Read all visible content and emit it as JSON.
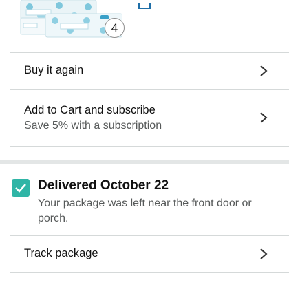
{
  "product": {
    "quantity": "4",
    "image": "tissue-pack-product-photo"
  },
  "actions": {
    "buy_again": "Buy it again",
    "subscribe_title": "Add to Cart and subscribe",
    "subscribe_sub": "Save 5% with a subscription"
  },
  "delivery": {
    "status": "Delivered October 22",
    "message": "Your package was left near the front door or porch.",
    "track": "Track package"
  },
  "colors": {
    "accent_teal": "#2fb5a6",
    "divider": "#d5d9d9",
    "secondary_text": "#565959"
  },
  "icons": [
    "checkmark-icon",
    "chevron-right-icon"
  ]
}
